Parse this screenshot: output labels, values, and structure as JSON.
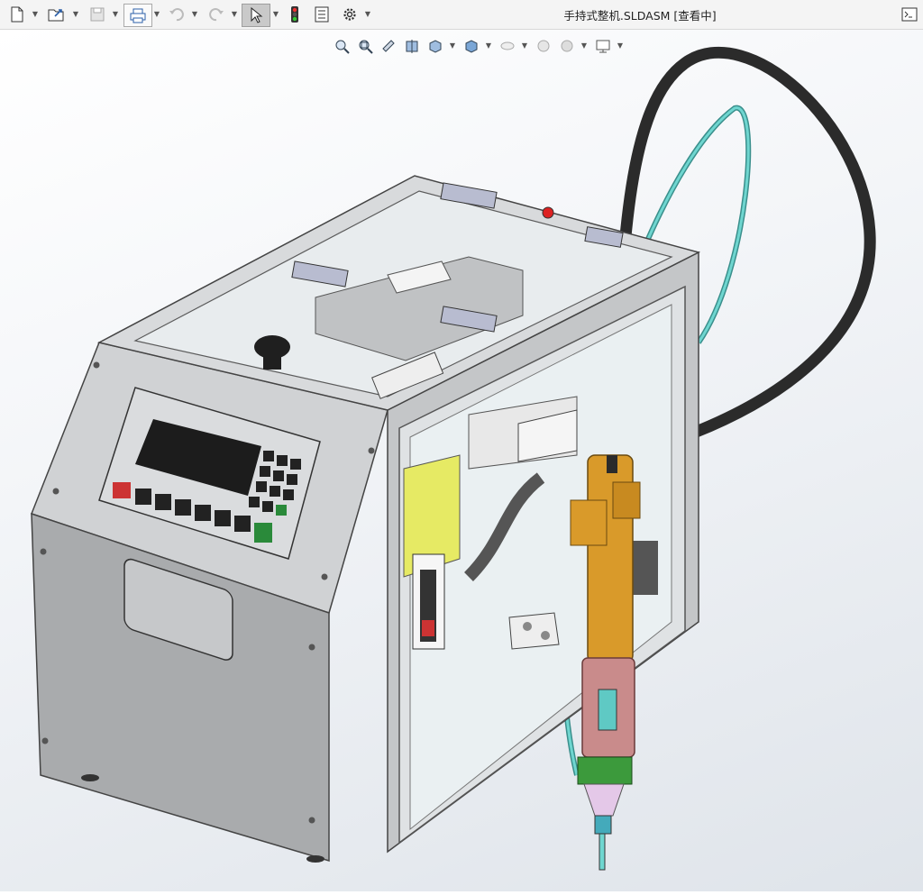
{
  "window": {
    "title": "手持式整机.SLDASM [查看中]"
  },
  "toolbar": {
    "buttons": [
      "new-document-icon",
      "open-icon",
      "save-icon",
      "print-icon",
      "undo-icon",
      "redo-icon",
      "select-pointer-icon",
      "traffic-light-icon",
      "file-properties-icon",
      "options-gear-icon"
    ]
  },
  "view_toolbar": {
    "buttons": [
      "zoom-to-fit-icon",
      "zoom-area-icon",
      "previous-view-icon",
      "section-view-icon",
      "view-orientation-icon",
      "display-style-icon",
      "hide-show-icon",
      "appearance-icon",
      "scene-icon",
      "view-settings-icon"
    ]
  },
  "colors": {
    "panel_gray": "#a9abad",
    "cover_gray": "#cfd1d3",
    "screw_gold": "#d99a2a",
    "hose_black": "#2b2b2b",
    "tube_cyan": "#5fc9c4",
    "copper_pink": "#c98b8b"
  }
}
